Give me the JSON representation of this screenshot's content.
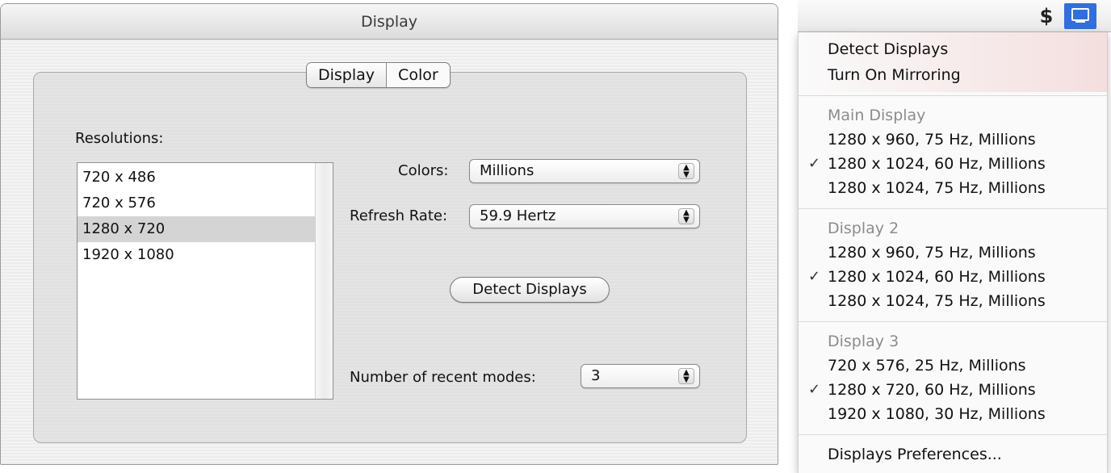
{
  "window": {
    "title": "Display",
    "tabs": [
      {
        "label": "Display",
        "selected": true
      },
      {
        "label": "Color",
        "selected": false
      }
    ],
    "resolutions_label": "Resolutions:",
    "resolutions": [
      {
        "label": "720 x 486",
        "selected": false
      },
      {
        "label": "720 x 576",
        "selected": false
      },
      {
        "label": "1280 x 720",
        "selected": true
      },
      {
        "label": "1920 x 1080",
        "selected": false
      }
    ],
    "colors_label": "Colors:",
    "colors_value": "Millions",
    "refresh_label": "Refresh Rate:",
    "refresh_value": "59.9 Hertz",
    "detect_button": "Detect Displays",
    "recent_modes_label": "Number of recent modes:",
    "recent_modes_value": "3"
  },
  "menubar": {
    "icons": [
      "dollar-sign-icon",
      "display-menu-icon"
    ],
    "accent": "#2f6fe0"
  },
  "menu": {
    "detect_displays": "Detect Displays",
    "turn_on_mirroring": "Turn On Mirroring",
    "sections": [
      {
        "header": "Main Display",
        "items": [
          {
            "label": "1280 x 960, 75 Hz, Millions",
            "checked": false
          },
          {
            "label": "1280 x 1024, 60 Hz, Millions",
            "checked": true
          },
          {
            "label": "1280 x 1024, 75 Hz, Millions",
            "checked": false
          }
        ]
      },
      {
        "header": "Display 2",
        "items": [
          {
            "label": "1280 x 960, 75 Hz, Millions",
            "checked": false
          },
          {
            "label": "1280 x 1024, 60 Hz, Millions",
            "checked": true
          },
          {
            "label": "1280 x 1024, 75 Hz, Millions",
            "checked": false
          }
        ]
      },
      {
        "header": "Display 3",
        "items": [
          {
            "label": "720 x 576, 25 Hz, Millions",
            "checked": false
          },
          {
            "label": "1280 x 720, 60 Hz, Millions",
            "checked": true
          },
          {
            "label": "1920 x 1080, 30 Hz, Millions",
            "checked": false
          }
        ]
      }
    ],
    "check_mark": "✓",
    "preferences": "Displays Preferences..."
  }
}
